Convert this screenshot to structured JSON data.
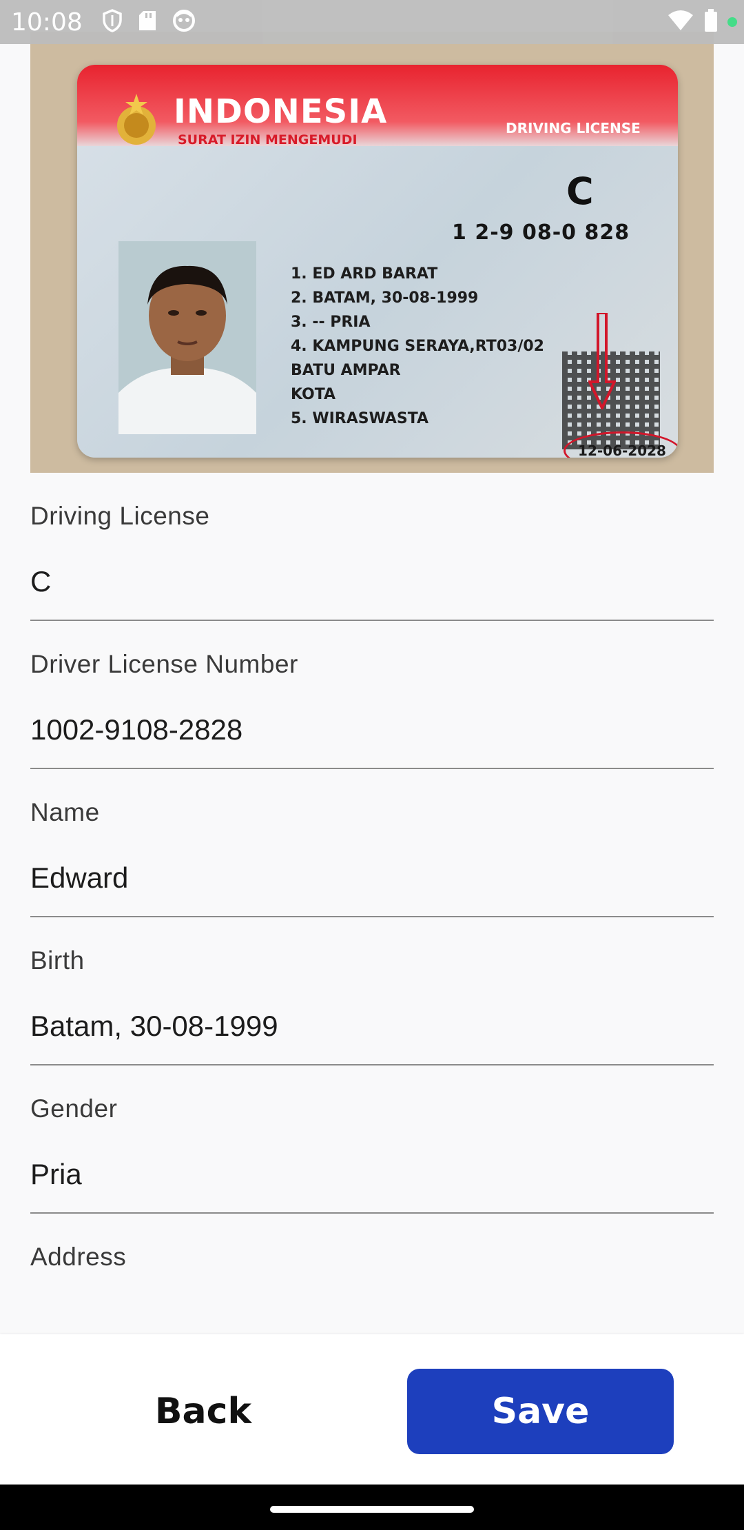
{
  "status_bar": {
    "time": "10:08",
    "icons": [
      "shield-icon",
      "sd-card-icon",
      "notification-face-icon",
      "wifi-icon",
      "battery-icon"
    ],
    "indicator_color": "#3ddc84"
  },
  "license_card": {
    "country": "INDONESIA",
    "subtitle": "SURAT IZIN MENGEMUDI",
    "type_label": "DRIVING LICENSE",
    "class": "C",
    "number": "1   2-9   08-0     828",
    "line1": "1. ED   ARD            BARAT",
    "line2": "2. BATAM, 30-08-1999",
    "line3": "3. -- PRIA",
    "line4": "4. KAMPUNG SERAYA,RT03/02",
    "line4b": "    BATU AMPAR",
    "line4c": "    KOTA",
    "line5": "5. WIRASWASTA",
    "expiry": "12-06-2028"
  },
  "form": {
    "fields": [
      {
        "label": "Driving License",
        "value": "C"
      },
      {
        "label": "Driver License Number",
        "value": "1002-9108-2828"
      },
      {
        "label": "Name",
        "value": "Edward"
      },
      {
        "label": "Birth",
        "value": "Batam, 30-08-1999"
      },
      {
        "label": "Gender",
        "value": "Pria"
      },
      {
        "label": "Address",
        "value": ""
      }
    ]
  },
  "actions": {
    "back_label": "Back",
    "save_label": "Save",
    "save_color": "#1d3fbd"
  }
}
